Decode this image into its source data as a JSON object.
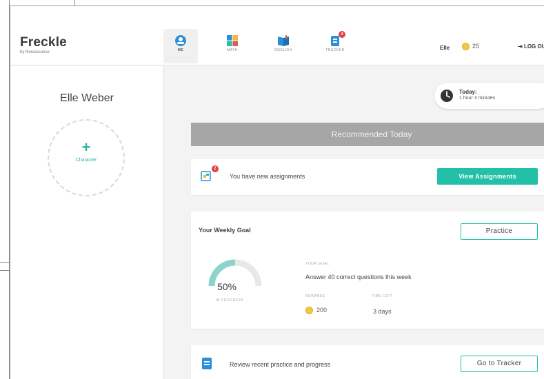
{
  "brand": {
    "title": "Freckle",
    "subtitle": "by Renaissance"
  },
  "nav": {
    "tabs": [
      {
        "label": "ME",
        "icon": "me-icon",
        "active": true
      },
      {
        "label": "MATH",
        "icon": "math-icon",
        "active": false
      },
      {
        "label": "ENGLISH",
        "icon": "english-icon",
        "active": false
      },
      {
        "label": "TRACKER",
        "icon": "tracker-icon",
        "active": false,
        "badge": "4"
      }
    ]
  },
  "header": {
    "user": "Elle",
    "coins": "25",
    "logout": "LOG OUT"
  },
  "sidebar": {
    "student_name": "Elle Weber",
    "character_label": "Character",
    "character_plus": "+"
  },
  "today": {
    "label": "Today:",
    "value": "1 hour 3 minutes"
  },
  "recommended": {
    "title": "Recommended Today"
  },
  "assignments": {
    "text": "You have new assignments",
    "button": "View Assignments",
    "badge": "2"
  },
  "weekly_goal": {
    "title": "Your Weekly Goal",
    "practice_button": "Practice",
    "percent": "50%",
    "progress": 0.5,
    "progress_label": "IN PROGRESS",
    "goal_label": "YOUR GOAL:",
    "goal_text": "Answer 40 correct questions this week",
    "rewards_label": "REWARDS",
    "rewards_value": "200",
    "time_left_label": "TIME LEFT",
    "time_left_value": "3 days"
  },
  "tracker": {
    "text": "Review recent practice and progress",
    "button": "Go to Tracker"
  },
  "colors": {
    "accent": "#22c0a7",
    "banner": "#a6a6a6",
    "coin": "#f2c744",
    "badge": "#e04040"
  }
}
